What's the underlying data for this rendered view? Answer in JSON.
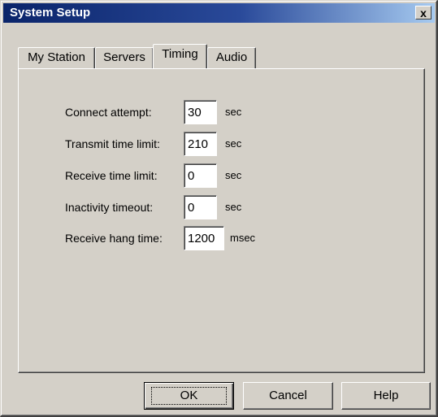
{
  "window": {
    "title": "System Setup",
    "close_label": "x"
  },
  "tabs": [
    {
      "label": "My Station",
      "active": false
    },
    {
      "label": "Servers",
      "active": false
    },
    {
      "label": "Timing",
      "active": true
    },
    {
      "label": "Audio",
      "active": false
    }
  ],
  "timing": {
    "fields": [
      {
        "label": "Connect attempt:",
        "value": "30",
        "unit": "sec"
      },
      {
        "label": "Transmit time limit:",
        "value": "210",
        "unit": "sec"
      },
      {
        "label": "Receive time limit:",
        "value": "0",
        "unit": "sec"
      },
      {
        "label": "Inactivity timeout:",
        "value": "0",
        "unit": "sec"
      },
      {
        "label": "Receive hang time:",
        "value": "1200",
        "unit": "msec"
      }
    ]
  },
  "buttons": {
    "ok": "OK",
    "cancel": "Cancel",
    "help": "Help"
  }
}
